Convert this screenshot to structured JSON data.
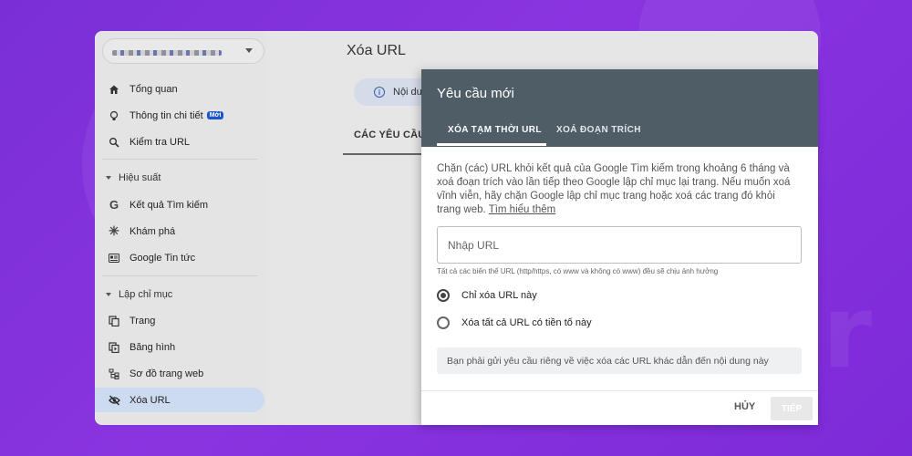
{
  "sidebar": {
    "items": [
      {
        "label": "Tổng quan",
        "icon": "home-icon"
      },
      {
        "label": "Thông tin chi tiết",
        "icon": "lightbulb-icon",
        "badge": "Mới"
      },
      {
        "label": "Kiểm tra URL",
        "icon": "search-icon"
      },
      {
        "label": "Kết quả Tìm kiếm",
        "icon": "google-g-icon"
      },
      {
        "label": "Khám phá",
        "icon": "asterisk-icon"
      },
      {
        "label": "Google Tin tức",
        "icon": "news-icon"
      },
      {
        "label": "Trang",
        "icon": "pages-icon"
      },
      {
        "label": "Băng hình",
        "icon": "video-icon"
      },
      {
        "label": "Sơ đồ trang web",
        "icon": "sitemap-icon"
      },
      {
        "label": "Xóa URL",
        "icon": "hidden-eye-icon"
      }
    ],
    "sections": {
      "performance": "Hiệu suất",
      "indexing": "Lập chỉ mục"
    }
  },
  "main": {
    "title": "Xóa URL",
    "info_text": "Nội dung",
    "tab_label": "CÁC YÊU CẦU"
  },
  "dialog": {
    "title": "Yêu cầu mới",
    "tabs": [
      "XÓA TẠM THỜI URL",
      "XOÁ ĐOẠN TRÍCH"
    ],
    "description": "Chặn (các) URL khỏi kết quả của Google Tìm kiếm trong khoảng 6 tháng và xoá đoạn trích vào lần tiếp theo Google lập chỉ mục lại trang. Nếu muốn xoá vĩnh viễn, hãy chặn Google lập chỉ mục trang hoặc xoá các trang đó khỏi trang web. ",
    "learn_more": "Tìm hiểu thêm",
    "url_placeholder": "Nhập URL",
    "url_value": "",
    "hint": "Tất cả các biến thể URL (http/https, có www và không có www) đều sẽ chịu ảnh hưởng",
    "options": [
      "Chỉ xóa URL này",
      "Xóa tất cả URL có tiền tố này"
    ],
    "selected_option": 0,
    "notice": "Bạn phải gửi yêu cầu riêng về việc xóa các URL khác dẫn đến nội dung này",
    "cancel_label": "HỦY",
    "next_label": "TIẾP"
  },
  "colors": {
    "background": "#8a34e0",
    "dialog_header": "#4f5d67",
    "active_nav": "#cddbf0",
    "badge": "#1a56c9"
  }
}
